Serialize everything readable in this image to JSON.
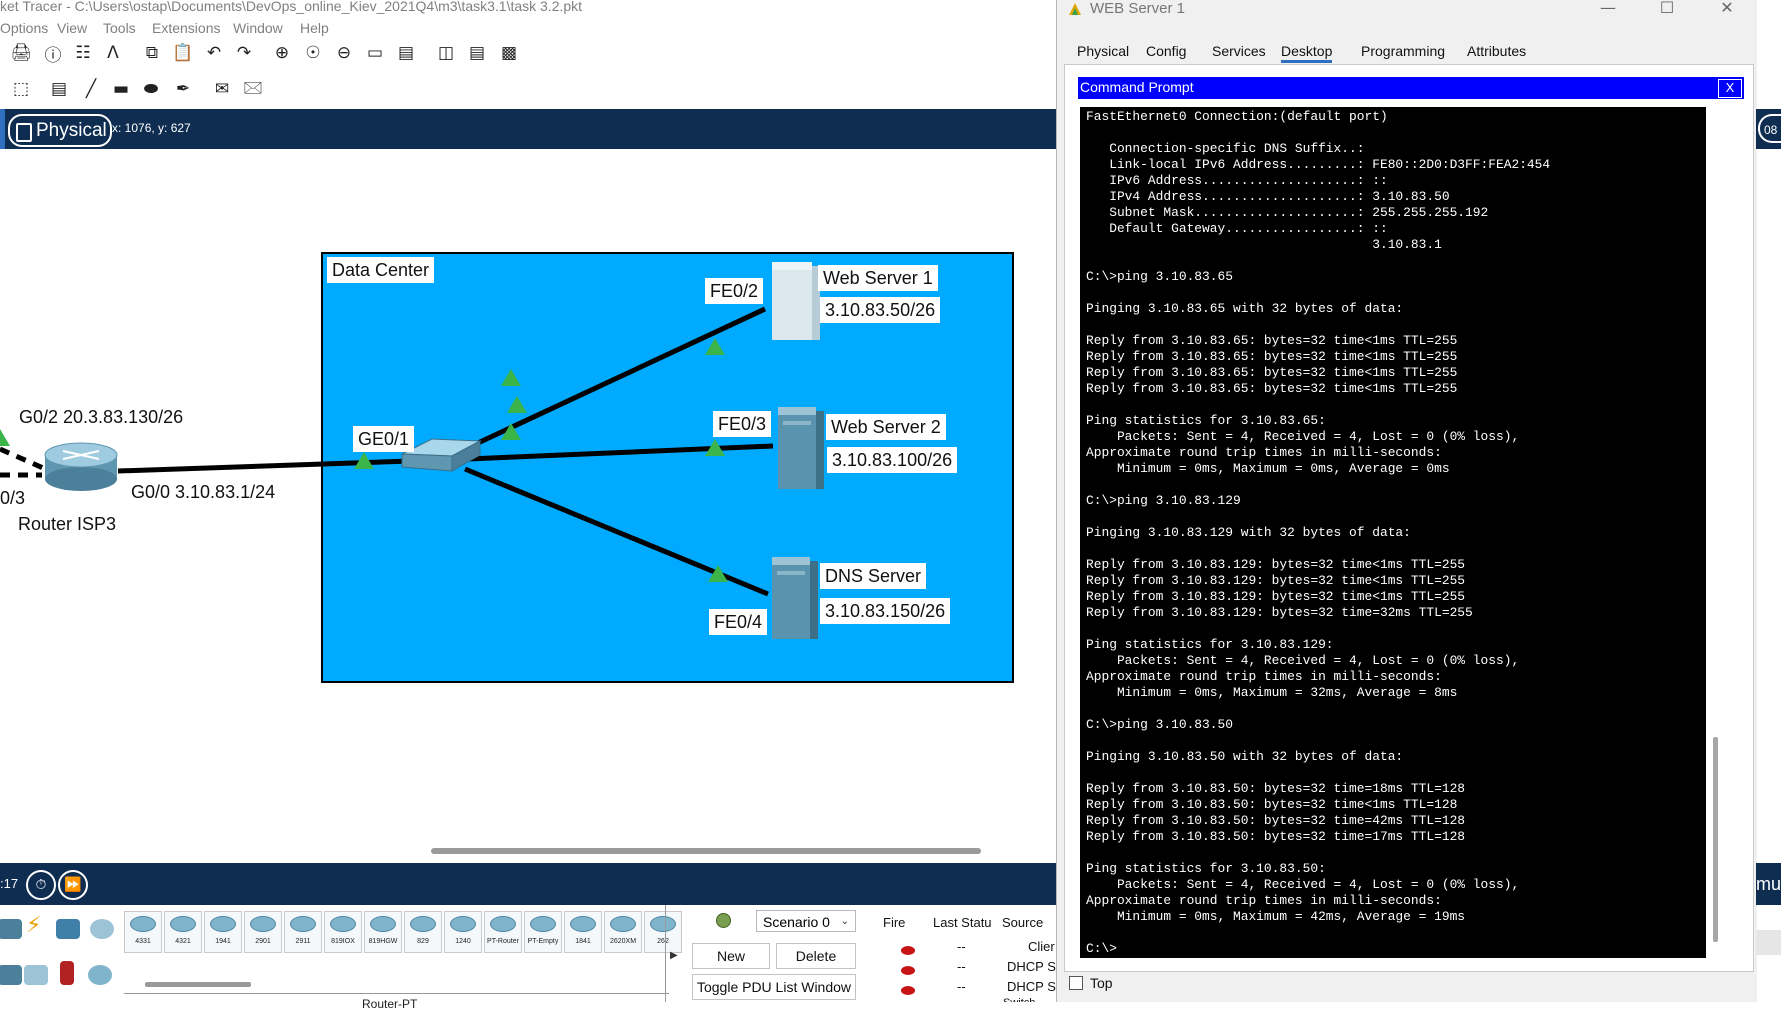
{
  "app": {
    "window_title": "ket Tracer - C:\\Users\\ostap\\Documents\\DevOps_online_Kiev_2021Q4\\m3\\task3.1\\task 3.2.pkt",
    "menu": [
      "Options",
      "View",
      "Tools",
      "Extensions",
      "Window",
      "Help"
    ]
  },
  "toolbar": {
    "row1_icons": [
      "print-icon",
      "info-icon",
      "network-wizard-icon",
      "activity-wizard-icon",
      "copy-icon",
      "paste-icon",
      "undo-icon",
      "redo-icon",
      "zoom-in-icon",
      "zoom-reset-icon",
      "zoom-out-icon",
      "drawing-palette-icon",
      "custom-device-icon",
      "pdu-icon",
      "cluster-icon",
      "image-icon"
    ],
    "row2_icons": [
      "select-icon",
      "inspect-icon",
      "note-icon",
      "line-icon",
      "rectangle-icon",
      "ellipse-icon",
      "freeform-icon",
      "simple-pdu-icon",
      "complex-pdu-icon"
    ]
  },
  "workspace": {
    "mode_tab": "Physical",
    "coordinates": "x: 1076, y: 627"
  },
  "topology": {
    "area_label": "Data Center",
    "labels": {
      "ws1_name": "Web Server 1",
      "ws1_ip": "3.10.83.50/26",
      "ws1_port": "FE0/2",
      "ws2_name": "Web Server 2",
      "ws2_ip": "3.10.83.100/26",
      "ws2_port": "FE0/3",
      "dns_name": "DNS Server",
      "dns_ip": "3.10.83.150/26",
      "dns_port": "FE0/4",
      "switch_port": "GE0/1",
      "router_g02": "G0/2  20.3.83.130/26",
      "router_g00": "G0/0  3.10.83.1/24",
      "router_03": "0/3",
      "router_name": "Router ISP3"
    }
  },
  "sim_bar": {
    "time": ":17"
  },
  "device_panel": {
    "models": [
      "4331",
      "4321",
      "1941",
      "2901",
      "2911",
      "819IOX",
      "819HGW",
      "829",
      "1240",
      "PT-Router",
      "PT-Empty",
      "1841",
      "2620XM",
      "262"
    ],
    "device_type_label": "Router-PT"
  },
  "scenario": {
    "selected": "Scenario 0",
    "new_label": "New",
    "delete_label": "Delete",
    "toggle_label": "Toggle PDU List Window"
  },
  "pdu_list": {
    "headers": [
      "Fire",
      "Last Statu",
      "Source"
    ],
    "rows": [
      {
        "last_status": "--",
        "source": "Clier"
      },
      {
        "last_status": "--",
        "source": "DHCP S"
      },
      {
        "last_status": "--",
        "source": "DHCP S"
      }
    ],
    "overflow_text": "Switch"
  },
  "web_server_window": {
    "title": "WEB Server 1",
    "tabs": [
      "Physical",
      "Config",
      "Services",
      "Desktop",
      "Programming",
      "Attributes"
    ],
    "active_tab": "Desktop",
    "cmd_title": "Command Prompt",
    "cmd_close": "X",
    "top_checkbox_label": "Top",
    "terminal_lines": [
      "FastEthernet0 Connection:(default port)",
      "",
      "   Connection-specific DNS Suffix..:",
      "   Link-local IPv6 Address.........: FE80::2D0:D3FF:FEA2:454",
      "   IPv6 Address....................: ::",
      "   IPv4 Address....................: 3.10.83.50",
      "   Subnet Mask.....................: 255.255.255.192",
      "   Default Gateway.................: ::",
      "                                     3.10.83.1",
      "",
      "C:\\>ping 3.10.83.65",
      "",
      "Pinging 3.10.83.65 with 32 bytes of data:",
      "",
      "Reply from 3.10.83.65: bytes=32 time<1ms TTL=255",
      "Reply from 3.10.83.65: bytes=32 time<1ms TTL=255",
      "Reply from 3.10.83.65: bytes=32 time<1ms TTL=255",
      "Reply from 3.10.83.65: bytes=32 time<1ms TTL=255",
      "",
      "Ping statistics for 3.10.83.65:",
      "    Packets: Sent = 4, Received = 4, Lost = 0 (0% loss),",
      "Approximate round trip times in milli-seconds:",
      "    Minimum = 0ms, Maximum = 0ms, Average = 0ms",
      "",
      "C:\\>ping 3.10.83.129",
      "",
      "Pinging 3.10.83.129 with 32 bytes of data:",
      "",
      "Reply from 3.10.83.129: bytes=32 time<1ms TTL=255",
      "Reply from 3.10.83.129: bytes=32 time<1ms TTL=255",
      "Reply from 3.10.83.129: bytes=32 time<1ms TTL=255",
      "Reply from 3.10.83.129: bytes=32 time=32ms TTL=255",
      "",
      "Ping statistics for 3.10.83.129:",
      "    Packets: Sent = 4, Received = 4, Lost = 0 (0% loss),",
      "Approximate round trip times in milli-seconds:",
      "    Minimum = 0ms, Maximum = 32ms, Average = 8ms",
      "",
      "C:\\>ping 3.10.83.50",
      "",
      "Pinging 3.10.83.50 with 32 bytes of data:",
      "",
      "Reply from 3.10.83.50: bytes=32 time=18ms TTL=128",
      "Reply from 3.10.83.50: bytes=32 time<1ms TTL=128",
      "Reply from 3.10.83.50: bytes=32 time=42ms TTL=128",
      "Reply from 3.10.83.50: bytes=32 time=17ms TTL=128",
      "",
      "Ping statistics for 3.10.83.50:",
      "    Packets: Sent = 4, Received = 4, Lost = 0 (0% loss),",
      "Approximate round trip times in milli-seconds:",
      "    Minimum = 0ms, Maximum = 42ms, Average = 19ms",
      "",
      "C:\\>"
    ]
  },
  "right_slice": {
    "top_tab_text": "08",
    "bottom_text": "mu"
  },
  "colors": {
    "navy_bar": "#0e2d50",
    "data_center_fill": "#00aaff",
    "cmd_header": "#0000ff",
    "link_up": "#3bb54a",
    "pdu_fail": "#c81414"
  }
}
